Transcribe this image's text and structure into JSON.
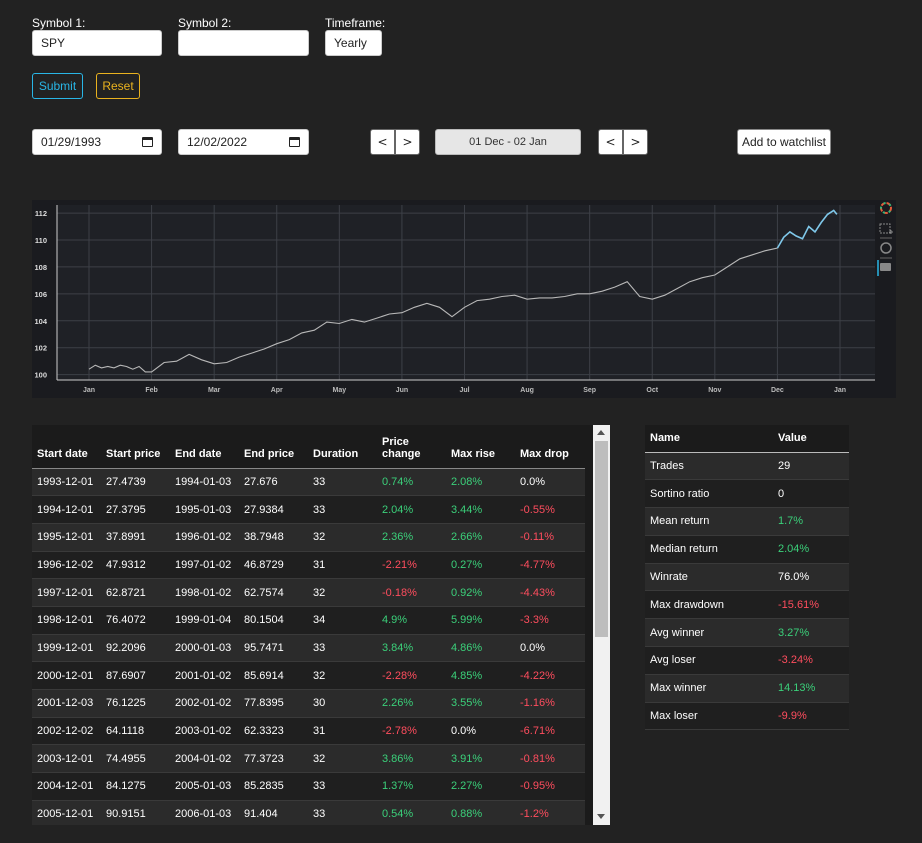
{
  "form": {
    "symbol1_label": "Symbol 1:",
    "symbol1_value": "SPY",
    "symbol2_label": "Symbol 2:",
    "symbol2_value": "",
    "timeframe_label": "Timeframe:",
    "timeframe_value": "Yearly",
    "submit_label": "Submit",
    "reset_label": "Reset"
  },
  "dates": {
    "start": "01/29/1993",
    "end": "12/02/2022",
    "prev1": "<",
    "next1": ">",
    "range": "01 Dec  -  02 Jan",
    "prev2": "<",
    "next2": ">",
    "watchlist_label": "Add to watchlist"
  },
  "chart_data": {
    "type": "line",
    "x_ticks": [
      "Jan",
      "Feb",
      "Mar",
      "Apr",
      "May",
      "Jun",
      "Jul",
      "Aug",
      "Sep",
      "Oct",
      "Nov",
      "Dec",
      "Jan"
    ],
    "y_ticks": [
      "100",
      "102",
      "104",
      "106",
      "108",
      "110",
      "112"
    ],
    "ylim": [
      99.6,
      112.6
    ],
    "grid": true,
    "series": [
      {
        "color": "#b8b8b8",
        "x": [
          0,
          0.1,
          0.2,
          0.3,
          0.4,
          0.5,
          0.6,
          0.7,
          0.8,
          0.9,
          1.0,
          1.2,
          1.4,
          1.6,
          1.8,
          2.0,
          2.2,
          2.4,
          2.6,
          2.8,
          3.0,
          3.2,
          3.4,
          3.6,
          3.8,
          4.0,
          4.2,
          4.4,
          4.6,
          4.8,
          5.0,
          5.2,
          5.4,
          5.6,
          5.8,
          6.0,
          6.2,
          6.4,
          6.6,
          6.8,
          7.0,
          7.2,
          7.4,
          7.6,
          7.8,
          8.0,
          8.2,
          8.4,
          8.6,
          8.8,
          9.0,
          9.2,
          9.4,
          9.6,
          9.8,
          10.0,
          10.2,
          10.4,
          10.6,
          10.8,
          11.0
        ],
        "y": [
          100.4,
          100.7,
          100.5,
          100.6,
          100.5,
          100.7,
          100.6,
          100.4,
          100.6,
          100.2,
          100.2,
          100.9,
          101.0,
          101.5,
          101.1,
          100.8,
          100.9,
          101.3,
          101.6,
          101.9,
          102.3,
          102.6,
          103.1,
          103.3,
          103.9,
          103.8,
          104.1,
          103.9,
          104.2,
          104.5,
          104.6,
          105.0,
          105.3,
          105.0,
          104.3,
          105.0,
          105.5,
          105.6,
          105.8,
          105.9,
          105.6,
          105.7,
          105.7,
          105.8,
          106.0,
          106.0,
          106.2,
          106.5,
          106.9,
          105.8,
          105.6,
          105.9,
          106.4,
          106.9,
          107.2,
          107.4,
          108.0,
          108.6,
          108.9,
          109.2,
          109.4
        ]
      },
      {
        "color": "#7fc8ea",
        "x": [
          11.0,
          11.1,
          11.2,
          11.3,
          11.4,
          11.5,
          11.6,
          11.7,
          11.8,
          11.9,
          11.95
        ],
        "y": [
          109.4,
          110.2,
          110.6,
          110.3,
          110.1,
          111.0,
          110.6,
          111.3,
          111.9,
          112.2,
          111.9
        ]
      }
    ]
  },
  "chart_tools": [
    "bokeh-logo-icon",
    "box-zoom-icon",
    "reset-icon",
    "hover-icon"
  ],
  "trades_table": {
    "headers": [
      "Start date",
      "Start price",
      "End date",
      "End price",
      "Duration",
      "Price change",
      "Max rise",
      "Max drop"
    ],
    "rows": [
      [
        "1993-12-01",
        "27.4739",
        "1994-01-03",
        "27.676",
        "33",
        "0.74%",
        "2.08%",
        "0.0%"
      ],
      [
        "1994-12-01",
        "27.3795",
        "1995-01-03",
        "27.9384",
        "33",
        "2.04%",
        "3.44%",
        "-0.55%"
      ],
      [
        "1995-12-01",
        "37.8991",
        "1996-01-02",
        "38.7948",
        "32",
        "2.36%",
        "2.66%",
        "-0.11%"
      ],
      [
        "1996-12-02",
        "47.9312",
        "1997-01-02",
        "46.8729",
        "31",
        "-2.21%",
        "0.27%",
        "-4.77%"
      ],
      [
        "1997-12-01",
        "62.8721",
        "1998-01-02",
        "62.7574",
        "32",
        "-0.18%",
        "0.92%",
        "-4.43%"
      ],
      [
        "1998-12-01",
        "76.4072",
        "1999-01-04",
        "80.1504",
        "34",
        "4.9%",
        "5.99%",
        "-3.3%"
      ],
      [
        "1999-12-01",
        "92.2096",
        "2000-01-03",
        "95.7471",
        "33",
        "3.84%",
        "4.86%",
        "0.0%"
      ],
      [
        "2000-12-01",
        "87.6907",
        "2001-01-02",
        "85.6914",
        "32",
        "-2.28%",
        "4.85%",
        "-4.22%"
      ],
      [
        "2001-12-03",
        "76.1225",
        "2002-01-02",
        "77.8395",
        "30",
        "2.26%",
        "3.55%",
        "-1.16%"
      ],
      [
        "2002-12-02",
        "64.1118",
        "2003-01-02",
        "62.3323",
        "31",
        "-2.78%",
        "0.0%",
        "-6.71%"
      ],
      [
        "2003-12-01",
        "74.4955",
        "2004-01-02",
        "77.3723",
        "32",
        "3.86%",
        "3.91%",
        "-0.81%"
      ],
      [
        "2004-12-01",
        "84.1275",
        "2005-01-03",
        "85.2835",
        "33",
        "1.37%",
        "2.27%",
        "-0.95%"
      ],
      [
        "2005-12-01",
        "90.9151",
        "2006-01-03",
        "91.404",
        "33",
        "0.54%",
        "0.88%",
        "-1.2%"
      ]
    ]
  },
  "stats_table": {
    "headers": [
      "Name",
      "Value"
    ],
    "rows": [
      [
        "Trades",
        "29"
      ],
      [
        "Sortino ratio",
        "0"
      ],
      [
        "Mean return",
        "1.7%"
      ],
      [
        "Median return",
        "2.04%"
      ],
      [
        "Winrate",
        "76.0%"
      ],
      [
        "Max drawdown",
        "-15.61%"
      ],
      [
        "Avg winner",
        "3.27%"
      ],
      [
        "Avg loser",
        "-3.24%"
      ],
      [
        "Max winner",
        "14.13%"
      ],
      [
        "Max loser",
        "-9.9%"
      ]
    ]
  },
  "colors": {
    "background": "#222222",
    "positive": "#3bd07a",
    "negative": "#ff4d5e",
    "submit": "#29b6e6",
    "reset": "#e9b21f",
    "chart_line": "#b8b8b8",
    "chart_highlight": "#7fc8ea"
  }
}
